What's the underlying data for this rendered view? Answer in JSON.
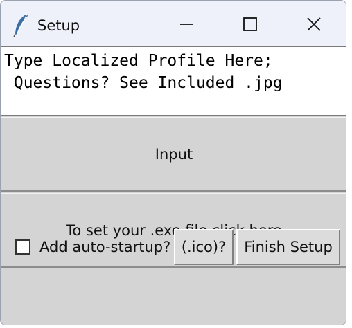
{
  "window": {
    "title": "Setup"
  },
  "titlebar": {
    "icons": [
      "feather-icon",
      "minimize-icon",
      "maximize-icon",
      "close-icon"
    ]
  },
  "textbox": {
    "value": "Type Localized Profile Here;\n Questions? See Included .jpg"
  },
  "buttons": {
    "input_label": "Input",
    "exe_label": "To set your .exe file click here",
    "ico_label": "(.ico)?",
    "finish_label": "Finish Setup"
  },
  "checkbox": {
    "label": "Add auto-startup?",
    "checked": false
  },
  "colors": {
    "titlebar_bg": "#eef1f9",
    "button_bg": "#d4d4d4",
    "textbox_bg": "#ffffff"
  }
}
